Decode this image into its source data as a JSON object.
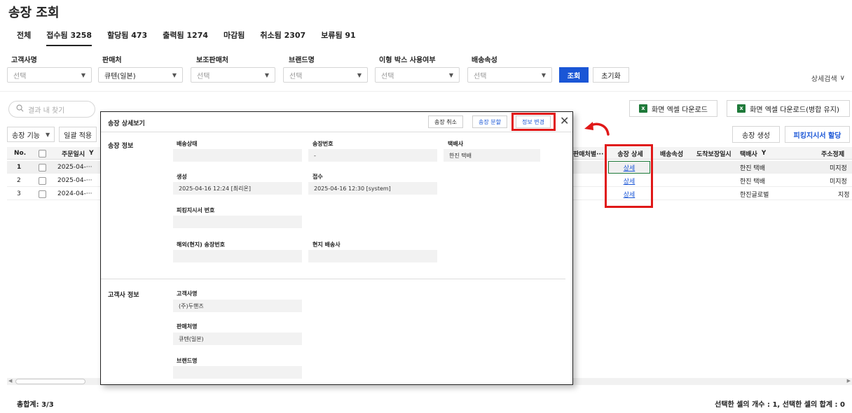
{
  "page": {
    "title": "송장 조회"
  },
  "tabs": [
    {
      "label": "전체",
      "active": false
    },
    {
      "label": "접수됨 3258",
      "active": true
    },
    {
      "label": "할당됨 473",
      "active": false
    },
    {
      "label": "출력됨 1274",
      "active": false
    },
    {
      "label": "마감됨",
      "active": false
    },
    {
      "label": "취소됨 2307",
      "active": false
    },
    {
      "label": "보류됨 91",
      "active": false
    }
  ],
  "filters": {
    "customer": {
      "label": "고객사명",
      "value": "선택"
    },
    "seller": {
      "label": "판매처",
      "value": "큐텐(일본)"
    },
    "sub_seller": {
      "label": "보조판매처",
      "value": "선택"
    },
    "brand": {
      "label": "브랜드명",
      "value": "선택"
    },
    "odd_box": {
      "label": "이형 박스 사용여부",
      "value": "선택"
    },
    "delivery_attr": {
      "label": "배송속성",
      "value": "선택"
    },
    "search_button": "조회",
    "reset_button": "초기화",
    "detail_search": "상세검색"
  },
  "result_search": {
    "placeholder": "결과 내 찾기"
  },
  "actions": {
    "excel_download": "화면 엑셀 다운로드",
    "excel_download_merged": "화면 엑셀 다운로드(병합 유지)",
    "create_invoice": "송장 생성",
    "assign_picking": "피킹지시서 할당"
  },
  "toolbar": {
    "invoice_function": "송장 기능",
    "bulk_apply": "일괄 적용"
  },
  "grid": {
    "headers": {
      "no": "No.",
      "order_date": "주문일시",
      "seller_attr": "판매처별···",
      "invoice_detail": "송장 상세",
      "delivery_attr": "배송속성",
      "arrival_date": "도착보장일시",
      "courier": "택배사",
      "address_info": "주소정제"
    },
    "rows": [
      {
        "no": "1",
        "order_date": "2025-04-···",
        "detail": "상세",
        "courier": "한진 택배",
        "address": "미지정"
      },
      {
        "no": "2",
        "order_date": "2025-04-···",
        "detail": "상세",
        "courier": "한진 택배",
        "address": "미지정"
      },
      {
        "no": "3",
        "order_date": "2024-04-···",
        "detail": "상세",
        "courier": "한진글로벌",
        "address": "지정"
      }
    ]
  },
  "footer": {
    "total": "총합계: 3/3",
    "selection": "선택한 셀의 개수 : 1, 선택한 셀의 합계 : 0"
  },
  "modal": {
    "title": "송장 상세보기",
    "cancel_button": "송장 취소",
    "split_button": "송장 분할",
    "edit_button": "정보 변경",
    "close_symbol": "✕",
    "invoice_section": "송장 정보",
    "customer_section": "고객사 정보",
    "fields": {
      "delivery_status": {
        "label": "배송상태",
        "value": ""
      },
      "invoice_number": {
        "label": "송장번호",
        "value": "-"
      },
      "courier": {
        "label": "택배사",
        "value": "한진 택배"
      },
      "created": {
        "label": "생성",
        "value": "2025-04-16 12:24 [최리온]"
      },
      "received": {
        "label": "접수",
        "value": "2025-04-16 12:30 [system]"
      },
      "picking_number": {
        "label": "피킹지시서 번호",
        "value": ""
      },
      "overseas_invoice": {
        "label": "해외(현지) 송장번호",
        "value": ""
      },
      "local_carrier": {
        "label": "현지 배송사",
        "value": ""
      },
      "customer_name": {
        "label": "고객사명",
        "value": "(주)두핸즈"
      },
      "seller_name": {
        "label": "판매처명",
        "value": "큐텐(일본)"
      },
      "brand_name": {
        "label": "브랜드명",
        "value": ""
      }
    }
  },
  "colors": {
    "primary": "#1a56d6",
    "highlight": "#e01818",
    "excel": "#1f7a3a"
  }
}
